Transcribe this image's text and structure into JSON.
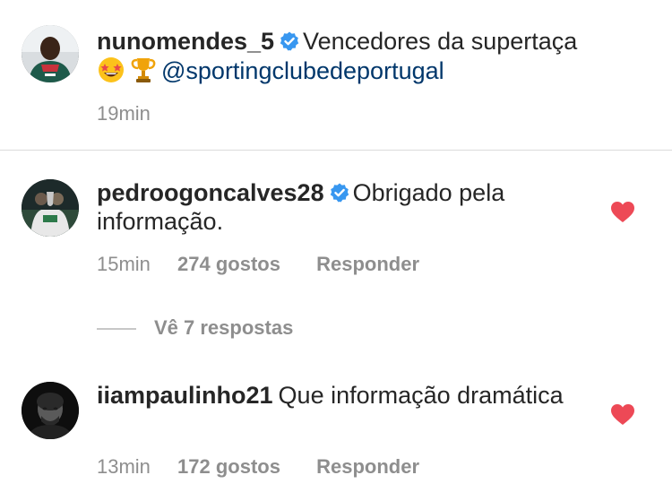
{
  "caption": {
    "username": "nunomendes_5",
    "text": "Vencedores da supertaça",
    "emojis": [
      "star-struck-emoji",
      "trophy-emoji"
    ],
    "mention": "@sportingclubedeportugal",
    "time": "19min"
  },
  "comments": [
    {
      "username": "pedroogoncalves28",
      "verified": true,
      "text": "Obrigado pela informação.",
      "time": "15min",
      "likes": "274 gostos",
      "reply_label": "Responder",
      "liked": true
    },
    {
      "username": "iiampaulinho21",
      "verified": false,
      "text": "Que informação dramática",
      "time": "13min",
      "likes": "172 gostos",
      "reply_label": "Responder",
      "liked": true
    }
  ],
  "view_replies": "Vê 7 respostas",
  "colors": {
    "verified_blue": "#3897f0",
    "heart_red": "#ed4956",
    "mention": "#00376b",
    "meta_gray": "#8e8e8e"
  }
}
